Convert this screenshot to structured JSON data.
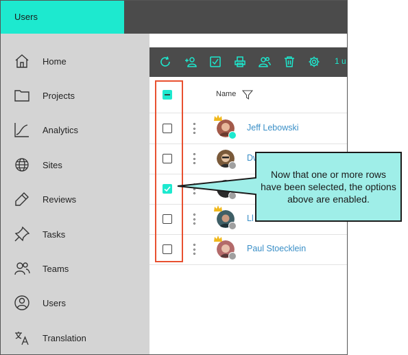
{
  "app": {
    "title": "Users"
  },
  "sidebar": {
    "items": [
      {
        "label": "Home",
        "icon": "home-icon"
      },
      {
        "label": "Projects",
        "icon": "folder-icon"
      },
      {
        "label": "Analytics",
        "icon": "analytics-icon"
      },
      {
        "label": "Sites",
        "icon": "globe-icon"
      },
      {
        "label": "Reviews",
        "icon": "pen-icon"
      },
      {
        "label": "Tasks",
        "icon": "pin-icon"
      },
      {
        "label": "Teams",
        "icon": "team-icon"
      },
      {
        "label": "Users",
        "icon": "user-circle-icon"
      },
      {
        "label": "Translation",
        "icon": "translate-icon"
      }
    ]
  },
  "toolbar": {
    "buttons": [
      "refresh-icon",
      "add-user-icon",
      "select-check-icon",
      "print-icon",
      "manage-users-icon",
      "delete-icon",
      "settings-icon"
    ],
    "selection_count": "1 u"
  },
  "table": {
    "header": {
      "name_label": "Name"
    },
    "rows": [
      {
        "name": "Jeff Lebowski",
        "checked": false,
        "status": "online",
        "crown": true
      },
      {
        "name": "Dw",
        "checked": false,
        "status": "offline",
        "crown": false
      },
      {
        "name": "",
        "checked": true,
        "status": "offline",
        "crown": false
      },
      {
        "name": "Ll",
        "checked": false,
        "status": "offline",
        "crown": true
      },
      {
        "name": "Paul Stoecklein",
        "checked": false,
        "status": "offline",
        "crown": true
      }
    ]
  },
  "callout": {
    "text": "Now that one or more rows have been selected, the options above are enabled."
  },
  "colors": {
    "accent": "#1de9cf",
    "dark_bar": "#4b4b4b",
    "highlight_border": "#e8502f",
    "callout_fill": "#9feee8",
    "link": "#3a8fc7"
  }
}
